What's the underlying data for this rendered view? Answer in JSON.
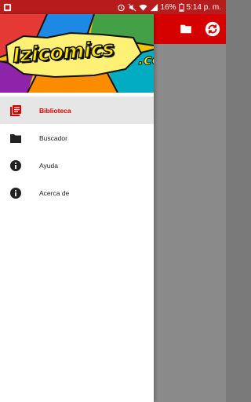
{
  "status_bar": {
    "battery_percent": "16%",
    "time": "5:14 p. m."
  },
  "drawer": {
    "logo": {
      "brand": "Izicomics",
      "suffix": ".co"
    },
    "menu_items": [
      {
        "label": "Biblioteca",
        "icon": "library-icon",
        "active": true
      },
      {
        "label": "Buscador",
        "icon": "folder-icon",
        "active": false
      },
      {
        "label": "Ayuda",
        "icon": "info-icon",
        "active": false
      },
      {
        "label": "Acerca de",
        "icon": "info-icon",
        "active": false
      }
    ]
  },
  "app_bar": {
    "actions": [
      "folder-icon",
      "sync-icon"
    ]
  },
  "colors": {
    "status_bar": "#b71c1c",
    "app_bar": "#d50000",
    "accent": "#d50000",
    "active_row": "#e6e6e6"
  }
}
